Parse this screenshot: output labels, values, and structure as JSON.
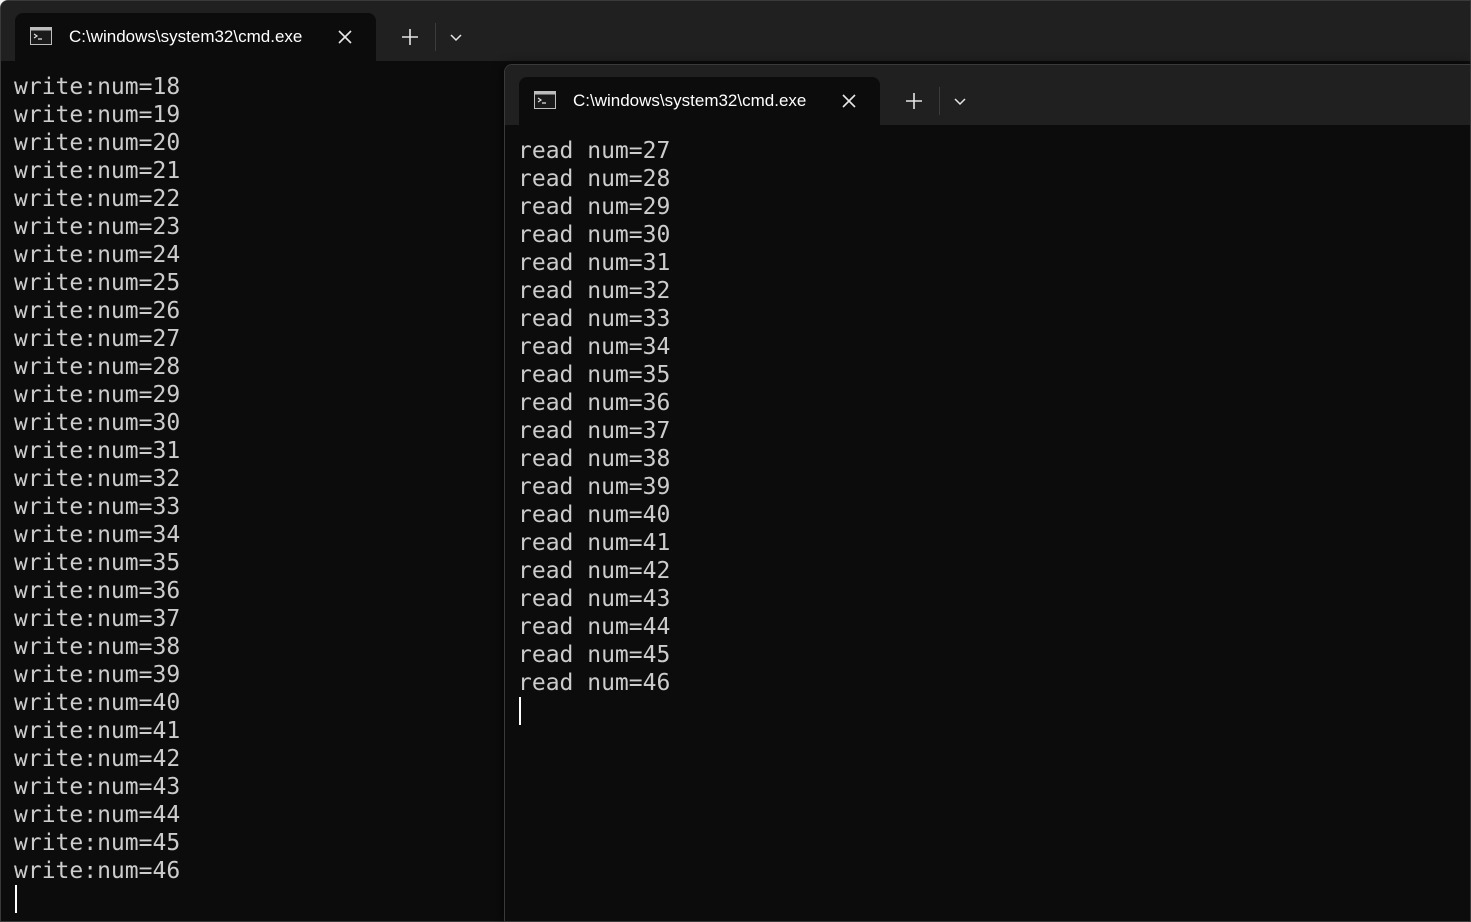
{
  "back_window": {
    "tab_title": "C:\\windows\\system32\\cmd.exe",
    "lines": [
      "write:num=18",
      "write:num=19",
      "write:num=20",
      "write:num=21",
      "write:num=22",
      "write:num=23",
      "write:num=24",
      "write:num=25",
      "write:num=26",
      "write:num=27",
      "write:num=28",
      "write:num=29",
      "write:num=30",
      "write:num=31",
      "write:num=32",
      "write:num=33",
      "write:num=34",
      "write:num=35",
      "write:num=36",
      "write:num=37",
      "write:num=38",
      "write:num=39",
      "write:num=40",
      "write:num=41",
      "write:num=42",
      "write:num=43",
      "write:num=44",
      "write:num=45",
      "write:num=46"
    ]
  },
  "front_window": {
    "tab_title": "C:\\windows\\system32\\cmd.exe",
    "lines": [
      "read num=27",
      "read num=28",
      "read num=29",
      "read num=30",
      "read num=31",
      "read num=32",
      "read num=33",
      "read num=34",
      "read num=35",
      "read num=36",
      "read num=37",
      "read num=38",
      "read num=39",
      "read num=40",
      "read num=41",
      "read num=42",
      "read num=43",
      "read num=44",
      "read num=45",
      "read num=46"
    ]
  },
  "icons": {
    "tab_icon": "terminal-icon",
    "close": "close-icon",
    "new_tab": "plus-icon",
    "dropdown": "chevron-down-icon"
  },
  "colors": {
    "console_bg": "#0c0c0c",
    "titlebar_bg": "#202020",
    "text": "#cccccc"
  }
}
